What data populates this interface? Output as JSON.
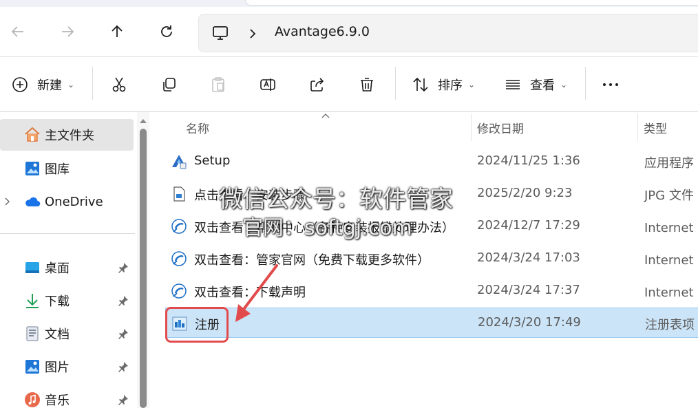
{
  "address": {
    "path": "Avantage6.9.0"
  },
  "toolbar": {
    "new_label": "新建",
    "sort_label": "排序",
    "view_label": "查看",
    "more_label": "···"
  },
  "sidebar": {
    "items": [
      {
        "label": "主文件夹",
        "icon": "home-icon"
      },
      {
        "label": "图库",
        "icon": "gallery-icon"
      },
      {
        "label": "OneDrive",
        "icon": "cloud-icon"
      },
      {
        "label": "桌面",
        "icon": "desktop-icon"
      },
      {
        "label": "下载",
        "icon": "download-icon"
      },
      {
        "label": "文档",
        "icon": "document-icon"
      },
      {
        "label": "图片",
        "icon": "pictures-icon"
      },
      {
        "label": "音乐",
        "icon": "music-icon"
      }
    ]
  },
  "columns": {
    "name": "名称",
    "date": "修改日期",
    "type": "类型"
  },
  "files": [
    {
      "name": "Setup",
      "date": "2024/11/25 1:36",
      "type": "应用程序",
      "icon": "setup-icon"
    },
    {
      "name": "点击查看：安装步骤",
      "date": "2025/2/20 9:23",
      "type": "JPG 文件",
      "icon": "image-file-icon"
    },
    {
      "name": "双击查看：帮助中心（各种安装报错处理办法）",
      "date": "2024/12/7 17:29",
      "type": "Internet 快",
      "icon": "internet-shortcut-icon"
    },
    {
      "name": "双击查看：管家官网（免费下载更多软件）",
      "date": "2024/3/24 17:03",
      "type": "Internet 快",
      "icon": "internet-shortcut-icon"
    },
    {
      "name": "双击查看：下载声明",
      "date": "2024/3/24 17:37",
      "type": "Internet 快",
      "icon": "internet-shortcut-icon"
    },
    {
      "name": "注册",
      "date": "2024/3/20 17:49",
      "type": "注册表项",
      "icon": "registry-icon"
    }
  ],
  "watermark": {
    "line1": "微信公众号：软件管家",
    "line2": "官网：softgj.com"
  },
  "colors": {
    "selection": "#cce4f7",
    "annotation": "#e24b4b",
    "accent": "#0067c0"
  }
}
